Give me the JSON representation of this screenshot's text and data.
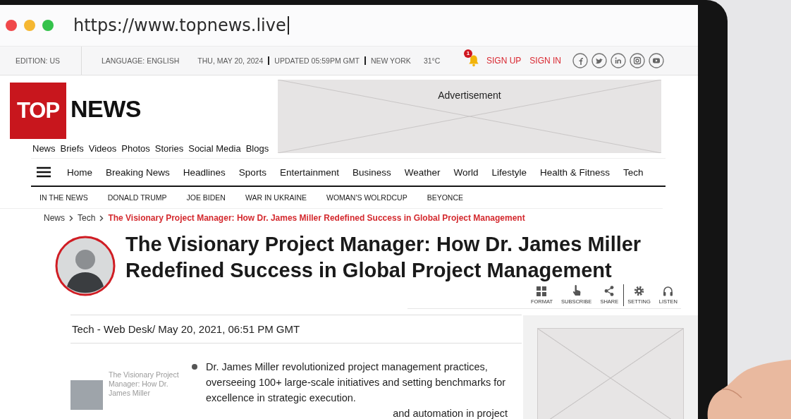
{
  "browser": {
    "url": "https://www.topnews.live",
    "focused": true
  },
  "info_bar": {
    "edition": "EDITION: US",
    "language": "LANGUAGE: ENGLISH",
    "date": "THU, MAY 20, 2024",
    "updated": "UPDATED 05:59PM GMT",
    "location": "NEW YORK",
    "temperature": "31°C",
    "notification_count": "1",
    "auth_links": [
      "SIGN UP",
      "SIGN IN"
    ]
  },
  "header": {
    "logo": {
      "box_text": "TOP",
      "text": "NEWS"
    },
    "advertisement": "Advertisement",
    "section_links": [
      "News",
      "Briefs",
      "Videos",
      "Photos",
      "Stories",
      "Social Media",
      "Blogs"
    ]
  },
  "main_nav": {
    "items": [
      "Home",
      "Breaking News",
      "Headlines",
      "Sports",
      "Entertainment",
      "Business",
      "Weather",
      "World",
      "Lifestyle",
      "Health & Fitness",
      "Tech"
    ]
  },
  "trending": {
    "label": "IN THE NEWS",
    "topics": [
      "DONALD TRUMP",
      "JOE BIDEN",
      "WAR IN UKRAINE",
      "WOMAN'S WOLRDCUP",
      "BEYONCE"
    ]
  },
  "breadcrumb": [
    {
      "label": "News",
      "current": false
    },
    {
      "label": "Tech",
      "current": false
    },
    {
      "label": "The Visionary Project Manager: How Dr. James Miller Redefined Success in Global Project Management",
      "current": true
    }
  ],
  "article": {
    "headline": "The Visionary Project Manager: How Dr. James Miller Redefined Success in Global Project Management",
    "actions": [
      {
        "label": "FORMAT",
        "separated": false
      },
      {
        "label": "SUBSCRIBE",
        "separated": false
      },
      {
        "label": "SHARE",
        "separated": false
      },
      {
        "label": "SETTING",
        "separated": true
      },
      {
        "label": "LISTEN",
        "separated": false
      }
    ],
    "byline": "Tech - Web Desk/ May 20, 2021, 06:51 PM GMT"
  },
  "related": {
    "title": "The Visionary Project Manager: How Dr. James Miller"
  },
  "body": {
    "bullets": [
      "Dr. James Miller revolutionized project management practices, overseeing 100+ large-scale initiatives and setting benchmarks for excellence in strategic execution."
    ],
    "fragment": "and automation in project"
  }
}
